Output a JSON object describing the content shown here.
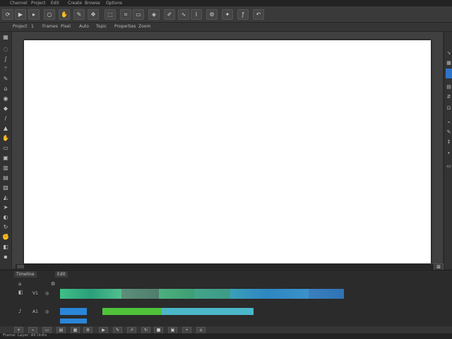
{
  "menu": {
    "items": [
      "Channel",
      "Project",
      "Edit",
      "Create",
      "Browse",
      "Options"
    ]
  },
  "toolbar": {
    "icons": [
      "rotate-icon",
      "play-icon",
      "circle-icon",
      "hand-icon",
      "move-icon",
      "square-icon",
      "crop-icon",
      "tools-icon",
      "transform-icon",
      "brush-icon",
      "chevron-icon",
      "settings-icon",
      "waveform-icon",
      "magic-icon",
      "fx-icon",
      "arrow-icon"
    ]
  },
  "options_bar": {
    "items": [
      "Project",
      "1",
      "Frames",
      "Pixel",
      "Auto",
      "Topic",
      "Properties",
      "Zoom"
    ]
  },
  "timeline": {
    "tabs": [
      "Timeline",
      "Edit"
    ],
    "track_labels": [
      "V1",
      "A1"
    ],
    "track_a_colors": [
      "#3fbf86",
      "#2f9f72",
      "#5c8f7a",
      "#4db07e",
      "#43a489",
      "#3aa0b8",
      "#2e86c2",
      "#3a7fbe"
    ],
    "track_b_colors": [
      "#2a86d8",
      "#2b2b2b",
      "#4fc23a",
      "#4cb7c9"
    ]
  },
  "status": {
    "text": "Frame: Layer: All Units"
  }
}
